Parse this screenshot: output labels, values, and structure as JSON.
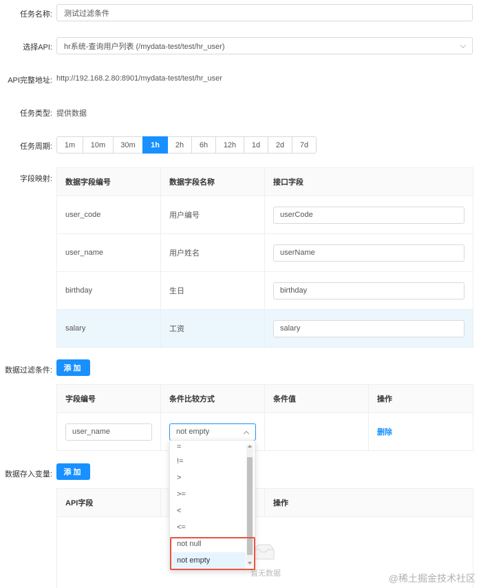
{
  "form": {
    "task_name_label": "任务名称:",
    "task_name_value": "测试过滤条件",
    "api_label": "选择API:",
    "api_value": "hr系统-查询用户列表 (/mydata-test/test/hr_user)",
    "api_url_label": "API完整地址:",
    "api_url_value": "http://192.168.2.80:8901/mydata-test/test/hr_user",
    "task_type_label": "任务类型:",
    "task_type_value": "提供数据",
    "period_label": "任务周期:",
    "periods": [
      "1m",
      "10m",
      "30m",
      "1h",
      "2h",
      "6h",
      "12h",
      "1d",
      "2d",
      "7d"
    ],
    "period_selected": "1h"
  },
  "field_mapping": {
    "label": "字段映射:",
    "headers": [
      "数据字段编号",
      "数据字段名称",
      "接口字段"
    ],
    "rows": [
      {
        "code": "user_code",
        "name": "用户编号",
        "api_field": "userCode"
      },
      {
        "code": "user_name",
        "name": "用户姓名",
        "api_field": "userName"
      },
      {
        "code": "birthday",
        "name": "生日",
        "api_field": "birthday"
      },
      {
        "code": "salary",
        "name": "工资",
        "api_field": "salary"
      }
    ]
  },
  "filter": {
    "label": "数据过滤条件:",
    "add_label": "添加",
    "headers": [
      "字段编号",
      "条件比较方式",
      "条件值",
      "操作"
    ],
    "row": {
      "field_code": "user_name",
      "operator": "not empty",
      "value": "",
      "delete_label": "删除"
    },
    "operator_options": [
      "=",
      "!=",
      ">",
      ">=",
      "<",
      "<=",
      "not null",
      "not empty"
    ]
  },
  "variables": {
    "label": "数据存入变量:",
    "add_label": "添加",
    "headers": [
      "API字段",
      "操作"
    ],
    "empty_text": "暂无数据"
  },
  "watermark": "@稀土掘金技术社区"
}
